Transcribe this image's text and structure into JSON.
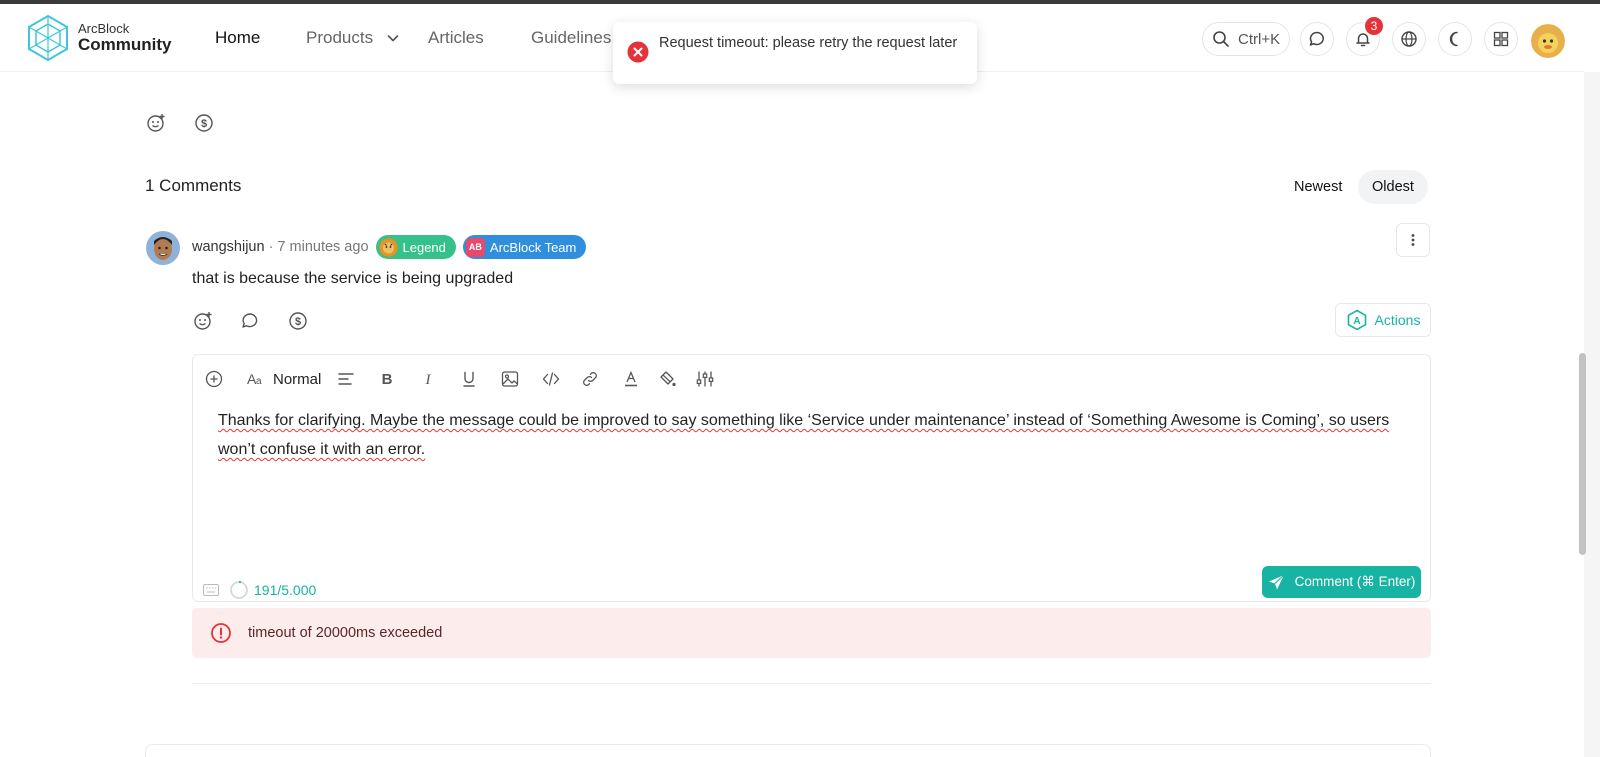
{
  "header": {
    "logo_top": "ArcBlock",
    "logo_bottom": "Community",
    "nav": {
      "home": "Home",
      "products": "Products",
      "articles": "Articles",
      "guidelines": "Guidelines"
    },
    "search_shortcut": "Ctrl+K",
    "notification_count": "3"
  },
  "toast": {
    "message": "Request timeout: please retry the request later"
  },
  "comments": {
    "title": "1 Comments",
    "sort_newest": "Newest",
    "sort_oldest": "Oldest",
    "items": [
      {
        "author": "wangshijun",
        "time": "· 7 minutes ago",
        "badges": [
          "Legend",
          "ArcBlock Team"
        ],
        "team_initials": "AB",
        "body": "that is because the service is being upgraded",
        "actions_label": "Actions"
      }
    ]
  },
  "editor": {
    "font_size_label": "Normal",
    "text": "Thanks for clarifying. Maybe the message could be improved to say something like ‘Service under maintenance’ instead of ‘Something Awesome is Coming’, so users won’t confuse it with an error.",
    "char_count": "191/5.000",
    "submit_label": "Comment (⌘ Enter)"
  },
  "error_alert": {
    "message": "timeout of 20000ms exceeded"
  },
  "colors": {
    "accent": "#17b3a3",
    "error": "#e5333c",
    "legend_chip": "#35c28a",
    "team_chip": "#2f8fdd"
  }
}
